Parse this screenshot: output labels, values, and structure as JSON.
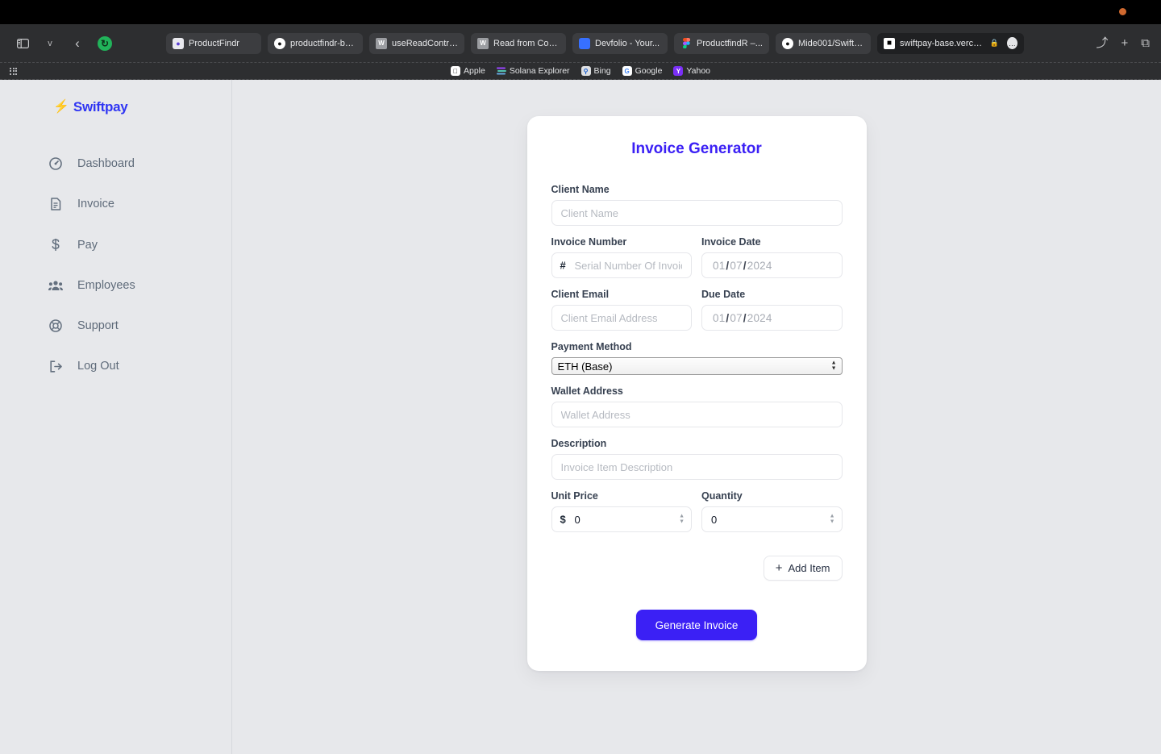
{
  "browser": {
    "toolbar": {
      "sidebar_toggle": "sidebar-toggle",
      "tab_overview_chevron": "v",
      "back": "‹",
      "reload": "↻",
      "share": "⤴",
      "new_tab": "+",
      "tab_groups": "⧉"
    },
    "tabs": [
      {
        "label": "ProductFindr",
        "favicon": "productfindr-icon",
        "active": false
      },
      {
        "label": "productfindr-ba...",
        "favicon": "github-icon",
        "active": false
      },
      {
        "label": "useReadContra...",
        "favicon": "wagmi-icon",
        "active": false
      },
      {
        "label": "Read from Cont...",
        "favicon": "wagmi-icon",
        "active": false
      },
      {
        "label": "Devfolio - Your...",
        "favicon": "devfolio-icon",
        "active": false
      },
      {
        "label": "ProductfindR –...",
        "favicon": "figma-icon",
        "active": false
      },
      {
        "label": "Mide001/Swiftp...",
        "favicon": "github-icon",
        "active": false
      },
      {
        "label": "swiftpay-base.vercel.app",
        "favicon": "vercel-icon",
        "active": true,
        "lock": "🔒",
        "more": "…"
      }
    ],
    "bookmarks": [
      {
        "label": "Apple",
        "icon": "apple-icon"
      },
      {
        "label": "Solana Explorer",
        "icon": "solana-icon"
      },
      {
        "label": "Bing",
        "icon": "bing-icon"
      },
      {
        "label": "Google",
        "icon": "google-icon"
      },
      {
        "label": "Yahoo",
        "icon": "yahoo-icon"
      }
    ]
  },
  "app": {
    "brand": {
      "name": "Swiftpay",
      "color": "#2f35f3"
    },
    "sidebar": {
      "items": [
        {
          "label": "Dashboard",
          "icon": "speedometer-icon"
        },
        {
          "label": "Invoice",
          "icon": "document-icon"
        },
        {
          "label": "Pay",
          "icon": "dollar-icon"
        },
        {
          "label": "Employees",
          "icon": "people-icon"
        },
        {
          "label": "Support",
          "icon": "lifebuoy-icon"
        },
        {
          "label": "Log Out",
          "icon": "logout-icon"
        }
      ]
    },
    "form": {
      "title": "Invoice Generator",
      "title_color": "#3b20f5",
      "client_name": {
        "label": "Client Name",
        "placeholder": "Client Name",
        "value": ""
      },
      "invoice_number": {
        "label": "Invoice Number",
        "prefix": "#",
        "placeholder": "Serial Number Of Invoice",
        "value": ""
      },
      "invoice_date": {
        "label": "Invoice Date",
        "value": "01/07/2024",
        "parts": [
          "01",
          "07",
          "2024"
        ]
      },
      "client_email": {
        "label": "Client Email",
        "placeholder": "Client Email Address",
        "value": ""
      },
      "due_date": {
        "label": "Due Date",
        "value": "01/07/2024",
        "parts": [
          "01",
          "07",
          "2024"
        ]
      },
      "payment_method": {
        "label": "Payment Method",
        "selected": "ETH (Base)",
        "options": [
          "ETH (Base)"
        ]
      },
      "wallet_address": {
        "label": "Wallet Address",
        "placeholder": "Wallet Address",
        "value": ""
      },
      "description": {
        "label": "Description",
        "placeholder": "Invoice Item Description",
        "value": ""
      },
      "unit_price": {
        "label": "Unit Price",
        "prefix": "$",
        "value": "0"
      },
      "quantity": {
        "label": "Quantity",
        "value": "0"
      },
      "add_item": {
        "label": "Add Item",
        "icon": "plus-icon"
      },
      "generate": {
        "label": "Generate Invoice",
        "color": "#3b20f5"
      }
    }
  }
}
